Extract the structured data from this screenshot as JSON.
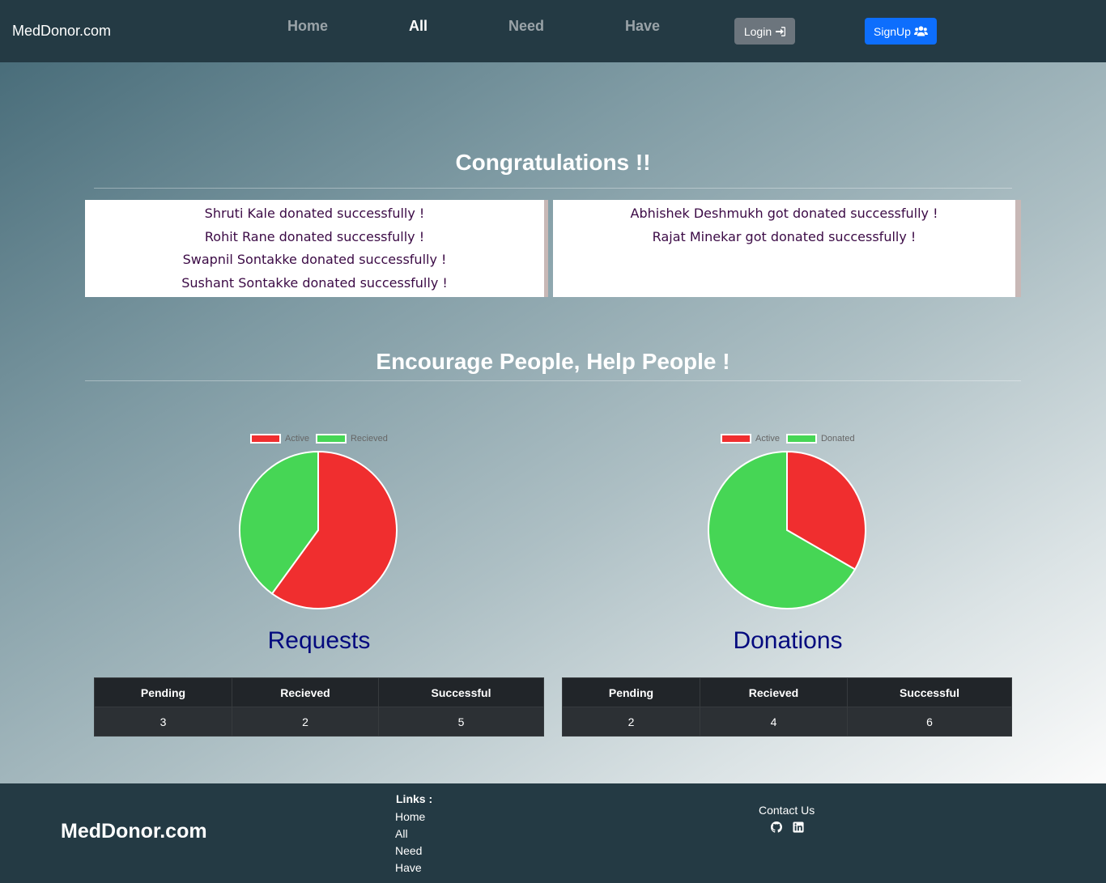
{
  "navbar": {
    "brand": "MedDonor.com",
    "links": [
      "Home",
      "All",
      "Need",
      "Have"
    ],
    "active": "All",
    "login_label": "Login",
    "signup_label": "SignUp"
  },
  "congratulations": {
    "title": "Congratulations !!",
    "donors": [
      "Shruti Kale donated successfully !",
      "Rohit Rane donated successfully !",
      "Swapnil Sontakke donated successfully !",
      "Sushant Sontakke donated successfully !"
    ],
    "receivers": [
      "Abhishek Deshmukh got donated successfully !",
      "Rajat Minekar got donated successfully !"
    ]
  },
  "encourage_title": "Encourage People, Help People !",
  "colors": {
    "active": "#f02e2f",
    "positive": "#46d655",
    "heading_blue": "#03097e"
  },
  "chart_data": [
    {
      "type": "pie",
      "title": "Requests",
      "labels": [
        "Active",
        "Recieved"
      ],
      "values": [
        3,
        2
      ],
      "colors": [
        "#f02e2f",
        "#46d655"
      ],
      "legend": "top"
    },
    {
      "type": "pie",
      "title": "Donations",
      "labels": [
        "Active",
        "Donated"
      ],
      "values": [
        2,
        4
      ],
      "colors": [
        "#f02e2f",
        "#46d655"
      ],
      "legend": "top"
    }
  ],
  "tables": {
    "requests": {
      "headers": [
        "Pending",
        "Recieved",
        "Successful"
      ],
      "values": [
        "3",
        "2",
        "5"
      ]
    },
    "donations": {
      "headers": [
        "Pending",
        "Recieved",
        "Successful"
      ],
      "values": [
        "2",
        "4",
        "6"
      ]
    }
  },
  "footer": {
    "brand": "MedDonor.com",
    "links_title": "Links :",
    "links": [
      "Home",
      "All",
      "Need",
      "Have"
    ],
    "contact_label": "Contact Us",
    "icons": [
      "github-icon",
      "linkedin-icon"
    ]
  }
}
